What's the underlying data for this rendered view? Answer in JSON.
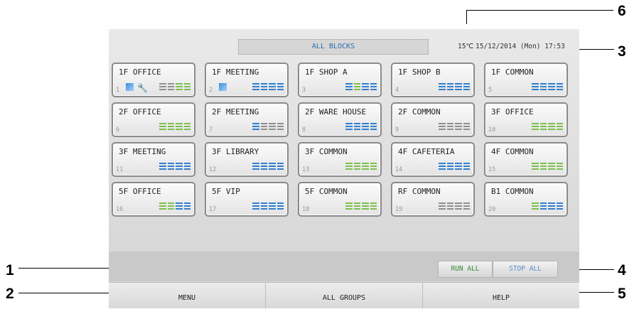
{
  "header": {
    "title": "ALL BLOCKS",
    "temperature": "15℃",
    "datetime": "15/12/2014 (Mon) 17:53"
  },
  "colors": {
    "green": "#7cc04c",
    "blue": "#2e7fd0",
    "gray": "#8f8f8f",
    "icon_blue": "#3f8ee0"
  },
  "blocks": [
    {
      "name": "1F OFFICE",
      "number": "1",
      "bars": [
        "gray",
        "gray",
        "green",
        "green"
      ],
      "icons": [
        "square-icon",
        "wrench-icon"
      ]
    },
    {
      "name": "1F MEETING",
      "number": "2",
      "bars": [
        "blue",
        "blue",
        "blue",
        "blue"
      ],
      "icons": [
        "square-icon"
      ]
    },
    {
      "name": "1F SHOP A",
      "number": "3",
      "bars": [
        "blue",
        "green",
        "blue",
        "blue"
      ],
      "icons": []
    },
    {
      "name": "1F SHOP B",
      "number": "4",
      "bars": [
        "blue",
        "blue",
        "blue",
        "blue"
      ],
      "icons": []
    },
    {
      "name": "1F COMMON",
      "number": "5",
      "bars": [
        "blue",
        "blue",
        "blue",
        "blue"
      ],
      "icons": []
    },
    {
      "name": "2F OFFICE",
      "number": "6",
      "bars": [
        "green",
        "green",
        "green",
        "green"
      ],
      "icons": []
    },
    {
      "name": "2F MEETING",
      "number": "7",
      "bars": [
        "blue",
        "gray",
        "gray",
        "gray"
      ],
      "icons": []
    },
    {
      "name": "2F WARE HOUSE",
      "number": "8",
      "bars": [
        "blue",
        "blue",
        "blue",
        "blue"
      ],
      "icons": []
    },
    {
      "name": "2F COMMON",
      "number": "9",
      "bars": [
        "gray",
        "gray",
        "gray",
        "gray"
      ],
      "icons": []
    },
    {
      "name": "3F OFFICE",
      "number": "10",
      "bars": [
        "green",
        "green",
        "green",
        "green"
      ],
      "icons": []
    },
    {
      "name": "3F MEETING",
      "number": "11",
      "bars": [
        "blue",
        "blue",
        "blue",
        "blue"
      ],
      "icons": []
    },
    {
      "name": "3F LIBRARY",
      "number": "12",
      "bars": [
        "blue",
        "blue",
        "blue",
        "blue"
      ],
      "icons": []
    },
    {
      "name": "3F COMMON",
      "number": "13",
      "bars": [
        "green",
        "green",
        "green",
        "green"
      ],
      "icons": []
    },
    {
      "name": "4F CAFETERIA",
      "number": "14",
      "bars": [
        "blue",
        "blue",
        "blue",
        "blue"
      ],
      "icons": []
    },
    {
      "name": "4F COMMON",
      "number": "15",
      "bars": [
        "green",
        "green",
        "green",
        "green"
      ],
      "icons": []
    },
    {
      "name": "5F OFFICE",
      "number": "16",
      "bars": [
        "green",
        "green",
        "blue",
        "blue"
      ],
      "icons": []
    },
    {
      "name": "5F VIP",
      "number": "17",
      "bars": [
        "blue",
        "blue",
        "blue",
        "blue"
      ],
      "icons": []
    },
    {
      "name": "5F COMMON",
      "number": "18",
      "bars": [
        "green",
        "green",
        "green",
        "green"
      ],
      "icons": []
    },
    {
      "name": "RF COMMON",
      "number": "19",
      "bars": [
        "gray",
        "gray",
        "gray",
        "gray"
      ],
      "icons": []
    },
    {
      "name": "B1 COMMON",
      "number": "20",
      "bars": [
        "green",
        "blue",
        "blue",
        "blue"
      ],
      "icons": []
    }
  ],
  "controls": {
    "run_all": "RUN ALL",
    "stop_all": "STOP ALL"
  },
  "menu": {
    "menu": "MENU",
    "all_groups": "ALL GROUPS",
    "help": "HELP"
  },
  "callouts": [
    "1",
    "2",
    "3",
    "4",
    "5",
    "6"
  ]
}
